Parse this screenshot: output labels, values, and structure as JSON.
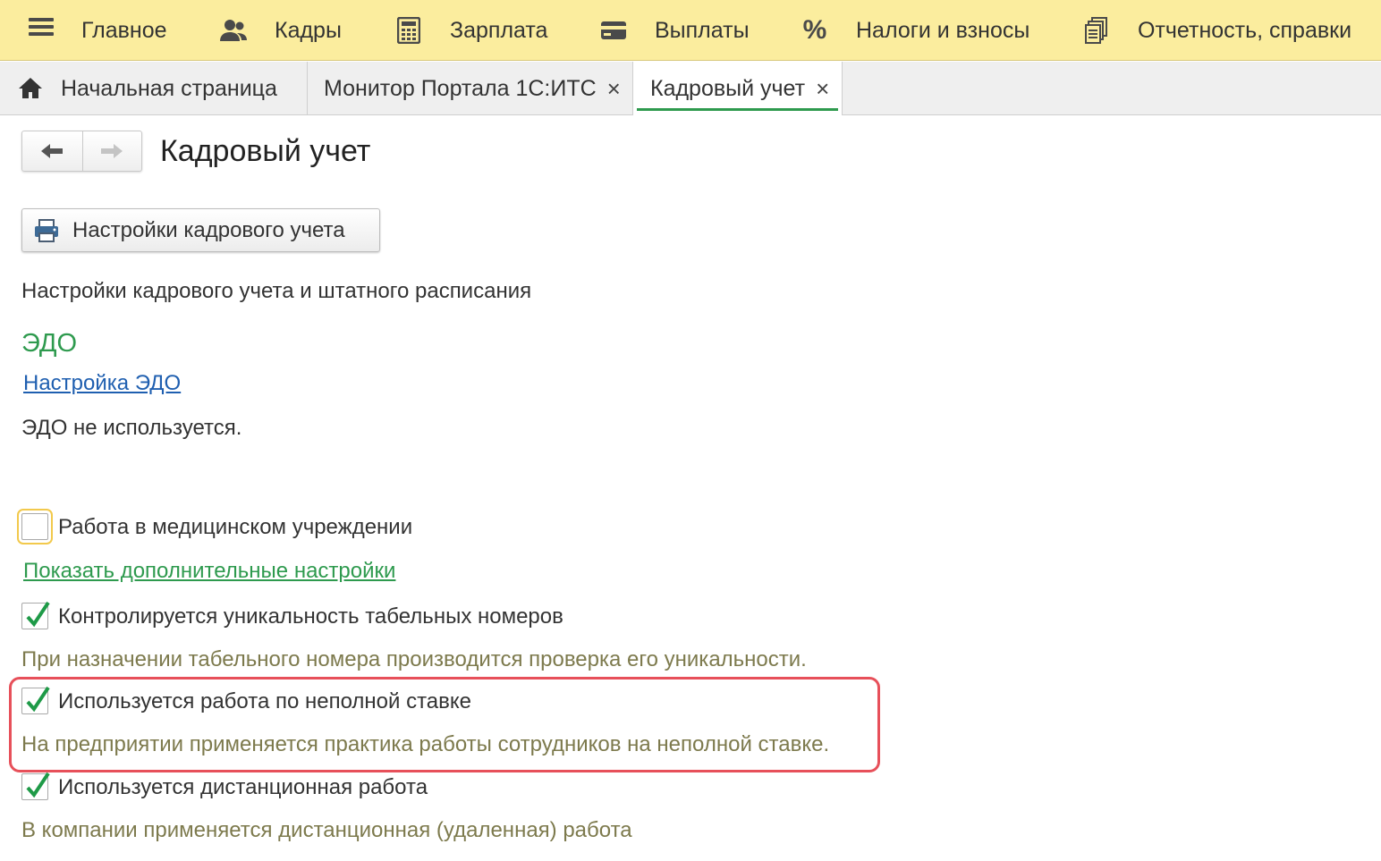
{
  "topbar": {
    "items": [
      {
        "label": "Главное",
        "icon": "menu-icon"
      },
      {
        "label": "Кадры",
        "icon": "people-icon"
      },
      {
        "label": "Зарплата",
        "icon": "calculator-icon"
      },
      {
        "label": "Выплаты",
        "icon": "card-icon"
      },
      {
        "label": "Налоги и взносы",
        "icon": "percent-icon"
      },
      {
        "label": "Отчетность, справки",
        "icon": "documents-icon"
      }
    ]
  },
  "tabs": [
    {
      "label": "Начальная страница",
      "icon": "home-icon"
    },
    {
      "label": "Монитор Портала 1С:ИТС",
      "close": "×"
    },
    {
      "label": "Кадровый учет",
      "close": "×",
      "active": true
    }
  ],
  "page": {
    "title": "Кадровый учет",
    "settings_button": "Настройки кадрового учета",
    "description": "Настройки кадрового учета и штатного расписания",
    "edo": {
      "title": "ЭДО",
      "link": "Настройка ЭДО",
      "status": "ЭДО не используется."
    },
    "medical": {
      "label": "Работа в медицинском учреждении",
      "checked": false
    },
    "more_link": "Показать дополнительные настройки",
    "options": [
      {
        "label": "Контролируется уникальность табельных номеров",
        "hint": "При назначении табельного номера производится проверка его уникальности.",
        "checked": true
      },
      {
        "label": "Используется работа по неполной ставке",
        "hint": "На предприятии применяется практика работы сотрудников на неполной ставке.",
        "checked": true
      },
      {
        "label": "Используется дистанционная работа",
        "hint": "В компании применяется дистанционная (удаленная) работа",
        "checked": true
      }
    ]
  },
  "colors": {
    "topbar_bg": "#fbed9e",
    "accent_green": "#2e9a4e",
    "link_blue": "#1f5fb0",
    "hint_text": "#7d7a4d",
    "highlight_red": "#e7505a"
  }
}
